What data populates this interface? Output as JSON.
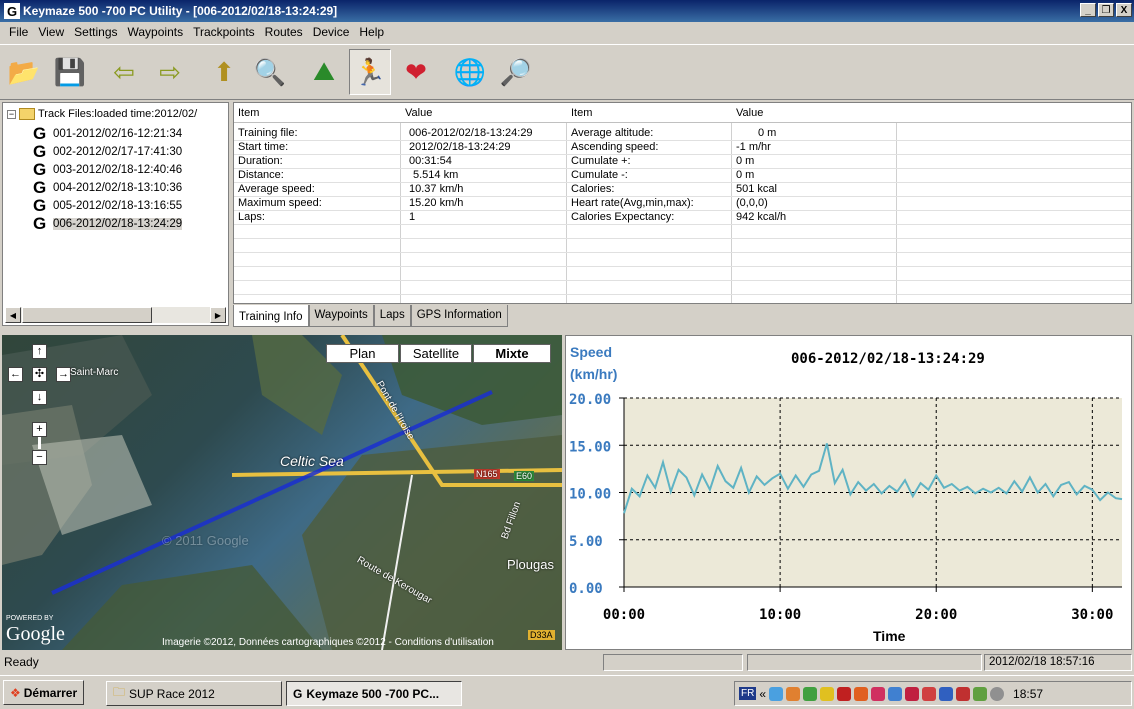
{
  "window": {
    "title": "Keymaze 500 -700 PC Utility - [006-2012/02/18-13:24:29]",
    "buttons": [
      "_",
      "❐",
      "X"
    ]
  },
  "menu": [
    "File",
    "View",
    "Settings",
    "Waypoints",
    "Trackpoints",
    "Routes",
    "Device",
    "Help"
  ],
  "toolbar": [
    {
      "name": "open-icon",
      "glyph": "📂"
    },
    {
      "name": "save-icon",
      "glyph": "💾"
    },
    {
      "name": "import-icon",
      "glyph": "⇦"
    },
    {
      "name": "export-icon",
      "glyph": "⇨"
    },
    {
      "name": "upload-icon",
      "glyph": "⬆"
    },
    {
      "name": "delete-search-icon",
      "glyph": "🔍"
    },
    {
      "name": "altitude-chart-icon",
      "glyph": "⛰"
    },
    {
      "name": "speed-runner-icon",
      "glyph": "🏃"
    },
    {
      "name": "heart-rate-icon",
      "glyph": "❤"
    },
    {
      "name": "globe-icon",
      "glyph": "🌐"
    },
    {
      "name": "globe-search-icon",
      "glyph": "🔎"
    }
  ],
  "tree": {
    "root": "Track Files:loaded time:2012/02/",
    "items": [
      "001-2012/02/16-12:21:34",
      "002-2012/02/17-17:41:30",
      "003-2012/02/18-12:40:46",
      "004-2012/02/18-13:10:36",
      "005-2012/02/18-13:16:55",
      "006-2012/02/18-13:24:29"
    ],
    "selected_index": 5
  },
  "grid": {
    "headers": [
      "Item",
      "Value",
      "Item",
      "Value"
    ],
    "left": [
      [
        "Training file:",
        "006-2012/02/18-13:24:29"
      ],
      [
        "Start time:",
        "2012/02/18-13:24:29"
      ],
      [
        "Duration:",
        "00:31:54"
      ],
      [
        "Distance:",
        "5.514 km"
      ],
      [
        "Average speed:",
        "10.37 km/h"
      ],
      [
        "Maximum speed:",
        "15.20 km/h"
      ],
      [
        "Laps:",
        "1"
      ]
    ],
    "right": [
      [
        "Average altitude:",
        "0 m"
      ],
      [
        "Ascending speed:",
        "-1    m/hr"
      ],
      [
        "Cumulate +:",
        "0 m"
      ],
      [
        "Cumulate -:",
        "0 m"
      ],
      [
        "Calories:",
        "501  kcal"
      ],
      [
        "Heart rate(Avg,min,max):",
        "(0,0,0)"
      ],
      [
        "Calories Expectancy:",
        "942  kcal/h"
      ]
    ]
  },
  "tabs": [
    "Training Info",
    "Waypoints",
    "Laps",
    "GPS Information"
  ],
  "active_tab": 0,
  "map": {
    "types": [
      "Plan",
      "Satellite",
      "Mixte"
    ],
    "labels": [
      "Celtic Sea",
      "Plougas",
      "Saint-Marc",
      "Pont de l'Iroise",
      "Route de Kerougar",
      "Bd Fillon",
      "N165",
      "E60",
      "D33A"
    ],
    "logo": "Google",
    "powered": "POWERED BY",
    "watermark": "© 2011 Google",
    "copyright": "Imagerie ©2012, Données cartographiques ©2012 - Conditions d'utilisation"
  },
  "chart_data": {
    "type": "line",
    "title": "006-2012/02/18-13:24:29",
    "ylabel_line1": "Speed",
    "ylabel_line2": "(km/hr)",
    "xlabel": "Time",
    "x_ticks": [
      "00:00",
      "10:00",
      "20:00",
      "30:00"
    ],
    "x_tick_values": [
      0,
      10,
      20,
      30
    ],
    "y_ticks": [
      "0.00",
      "5.00",
      "10.00",
      "15.00",
      "20.00"
    ],
    "y_tick_values": [
      0,
      5,
      10,
      15,
      20
    ],
    "ylim": [
      0,
      20
    ],
    "xlim": [
      0,
      31.9
    ],
    "grid": true,
    "series": [
      {
        "color": "#5fb3c4",
        "x": [
          0,
          0.5,
          1,
          1.5,
          2,
          2.5,
          3,
          3.5,
          4,
          4.5,
          5,
          5.5,
          6,
          6.5,
          7,
          7.5,
          8,
          8.5,
          9,
          9.5,
          10,
          10.5,
          11,
          11.5,
          12,
          12.5,
          13,
          13.5,
          14,
          14.5,
          15,
          15.5,
          16,
          16.5,
          17,
          17.5,
          18,
          18.5,
          19,
          19.5,
          20,
          20.5,
          21,
          21.5,
          22,
          22.5,
          23,
          23.5,
          24,
          24.5,
          25,
          25.5,
          26,
          26.5,
          27,
          27.5,
          28,
          28.5,
          29,
          29.5,
          30,
          30.5,
          31,
          31.5,
          31.9
        ],
        "y": [
          7.8,
          10.4,
          9.6,
          11.8,
          10.5,
          13.2,
          10.1,
          12.4,
          11.6,
          9.7,
          11.9,
          10.3,
          12.8,
          11.2,
          10.5,
          12.6,
          10.0,
          11.7,
          10.8,
          11.5,
          12.0,
          10.4,
          11.8,
          10.6,
          11.9,
          12.3,
          15.2,
          11.0,
          12.4,
          9.8,
          11.1,
          10.2,
          10.9,
          9.9,
          10.7,
          10.1,
          11.3,
          9.6,
          11.0,
          10.3,
          11.8,
          10.5,
          10.9,
          10.2,
          10.6,
          9.9,
          10.4,
          10.0,
          10.5,
          9.9,
          11.2,
          10.1,
          11.6,
          10.0,
          10.9,
          9.6,
          10.8,
          11.1,
          9.8,
          10.7,
          10.3,
          9.2,
          10.0,
          9.4,
          9.3
        ]
      }
    ]
  },
  "status": {
    "left": "Ready",
    "datetime": "2012/02/18 18:57:16"
  },
  "taskbar": {
    "start": "Démarrer",
    "tasks": [
      "SUP Race 2012",
      "Keymaze 500 -700 PC..."
    ],
    "lang": "FR",
    "clock": "18:57"
  },
  "colors": {
    "title_bar": "#0a246a",
    "chart_bg": "#ece9d8",
    "track": "#1a2fd0",
    "series": "#5fb3c4"
  }
}
